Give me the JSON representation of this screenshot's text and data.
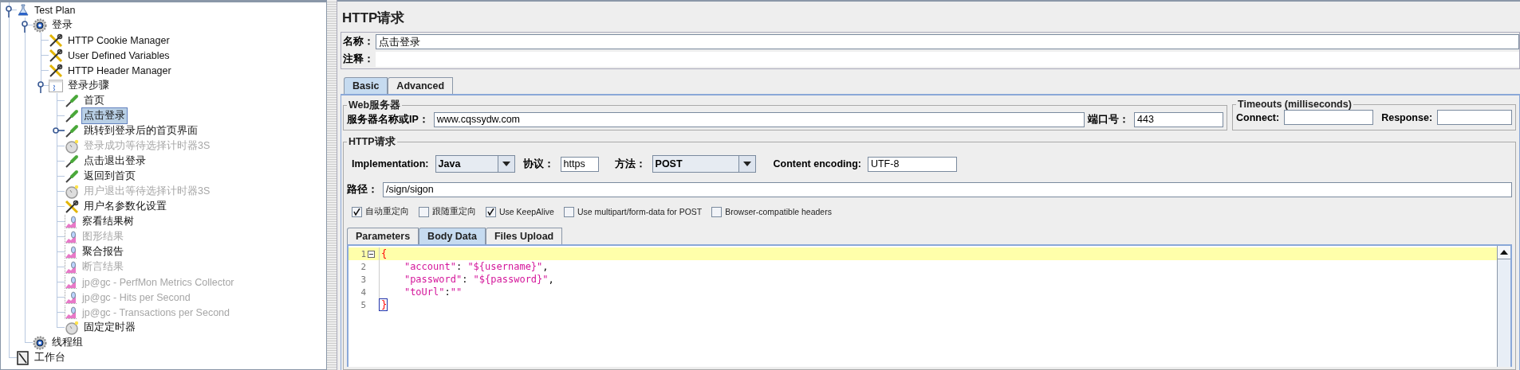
{
  "tree": [
    {
      "label": "Test Plan",
      "kind": "testplan",
      "expanded": true,
      "disabled": false,
      "selected": false,
      "children": [
        {
          "label": "登录",
          "kind": "threadgroup",
          "expanded": true,
          "disabled": false,
          "selected": false,
          "children": [
            {
              "label": "HTTP Cookie Manager",
              "kind": "config",
              "disabled": false,
              "selected": false
            },
            {
              "label": "User Defined Variables",
              "kind": "config",
              "disabled": false,
              "selected": false
            },
            {
              "label": "HTTP Header Manager",
              "kind": "config",
              "disabled": false,
              "selected": false
            },
            {
              "label": "登录步骤",
              "kind": "controller",
              "expanded": true,
              "disabled": false,
              "selected": false,
              "children": [
                {
                  "label": "首页",
                  "kind": "sampler",
                  "disabled": false,
                  "selected": false
                },
                {
                  "label": "点击登录",
                  "kind": "sampler",
                  "disabled": false,
                  "selected": true
                },
                {
                  "label": "跳转到登录后的首页界面",
                  "kind": "sampler",
                  "expanded": false,
                  "disabled": false,
                  "selected": false
                },
                {
                  "label": "登录成功等待选择计时器3S",
                  "kind": "timer",
                  "disabled": true,
                  "selected": false
                },
                {
                  "label": "点击退出登录",
                  "kind": "sampler",
                  "disabled": false,
                  "selected": false
                },
                {
                  "label": "返回到首页",
                  "kind": "sampler",
                  "disabled": false,
                  "selected": false
                },
                {
                  "label": "用户退出等待选择计时器3S",
                  "kind": "timer",
                  "disabled": true,
                  "selected": false
                },
                {
                  "label": "用户名参数化设置",
                  "kind": "config",
                  "disabled": false,
                  "selected": false
                },
                {
                  "label": "察看结果树",
                  "kind": "listener",
                  "disabled": false,
                  "selected": false
                },
                {
                  "label": "图形结果",
                  "kind": "listener",
                  "disabled": true,
                  "selected": false
                },
                {
                  "label": "聚合报告",
                  "kind": "listener",
                  "disabled": false,
                  "selected": false
                },
                {
                  "label": "断言结果",
                  "kind": "listener",
                  "disabled": true,
                  "selected": false
                },
                {
                  "label": "jp@gc - PerfMon Metrics Collector",
                  "kind": "listener",
                  "disabled": true,
                  "selected": false
                },
                {
                  "label": "jp@gc - Hits per Second",
                  "kind": "listener",
                  "disabled": true,
                  "selected": false
                },
                {
                  "label": "jp@gc - Transactions per Second",
                  "kind": "listener",
                  "disabled": true,
                  "selected": false
                },
                {
                  "label": "固定定时器",
                  "kind": "timer",
                  "disabled": false,
                  "selected": false
                }
              ]
            }
          ]
        },
        {
          "label": "线程组",
          "kind": "threadgroup",
          "disabled": false,
          "selected": false
        }
      ]
    },
    {
      "label": "工作台",
      "kind": "workbench",
      "disabled": false,
      "selected": false
    }
  ],
  "panel": {
    "title": "HTTP请求",
    "name_label": "名称：",
    "name": "点击登录",
    "comment_label": "注释："
  },
  "tabs": [
    {
      "label": "Basic",
      "selected": true
    },
    {
      "label": "Advanced",
      "selected": false
    }
  ],
  "web_server": {
    "title": "Web服务器",
    "server_label": "服务器名称或IP：",
    "server": "www.cqssydw.com",
    "port_label": "端口号：",
    "port": "443"
  },
  "timeouts": {
    "title": "Timeouts (milliseconds)",
    "connect_label": "Connect:",
    "response_label": "Response:"
  },
  "http_request": {
    "title": "HTTP请求",
    "implementation_label": "Implementation:",
    "implementation": "Java",
    "protocol_label": "协议：",
    "protocol": "https",
    "method_label": "方法：",
    "method": "POST",
    "encoding_label": "Content encoding:",
    "encoding": "UTF-8",
    "path_label": "路径：",
    "path": "/sign/sigon"
  },
  "options": [
    {
      "label": "自动重定向",
      "checked": true
    },
    {
      "label": "跟随重定向",
      "checked": false
    },
    {
      "label": "Use KeepAlive",
      "checked": true
    },
    {
      "label": "Use multipart/form-data for POST",
      "checked": false
    },
    {
      "label": "Browser-compatible headers",
      "checked": false
    }
  ],
  "body_tabs": [
    {
      "label": "Parameters",
      "selected": false
    },
    {
      "label": "Body Data",
      "selected": true
    },
    {
      "label": "Files Upload",
      "selected": false
    }
  ],
  "body_lines": [
    {
      "number": "1",
      "text": "{",
      "current": true,
      "foldable": true,
      "bracket_match": false
    },
    {
      "number": "2",
      "text": "    \"account\": \"${username}\",",
      "current": false,
      "foldable": false,
      "bracket_match": false
    },
    {
      "number": "3",
      "text": "    \"password\": \"${password}\",",
      "current": false,
      "foldable": false,
      "bracket_match": false
    },
    {
      "number": "4",
      "text": "    \"toUrl\":\"\"",
      "current": false,
      "foldable": false,
      "bracket_match": false
    },
    {
      "number": "5",
      "text": "}",
      "current": false,
      "foldable": false,
      "bracket_match": true
    }
  ]
}
